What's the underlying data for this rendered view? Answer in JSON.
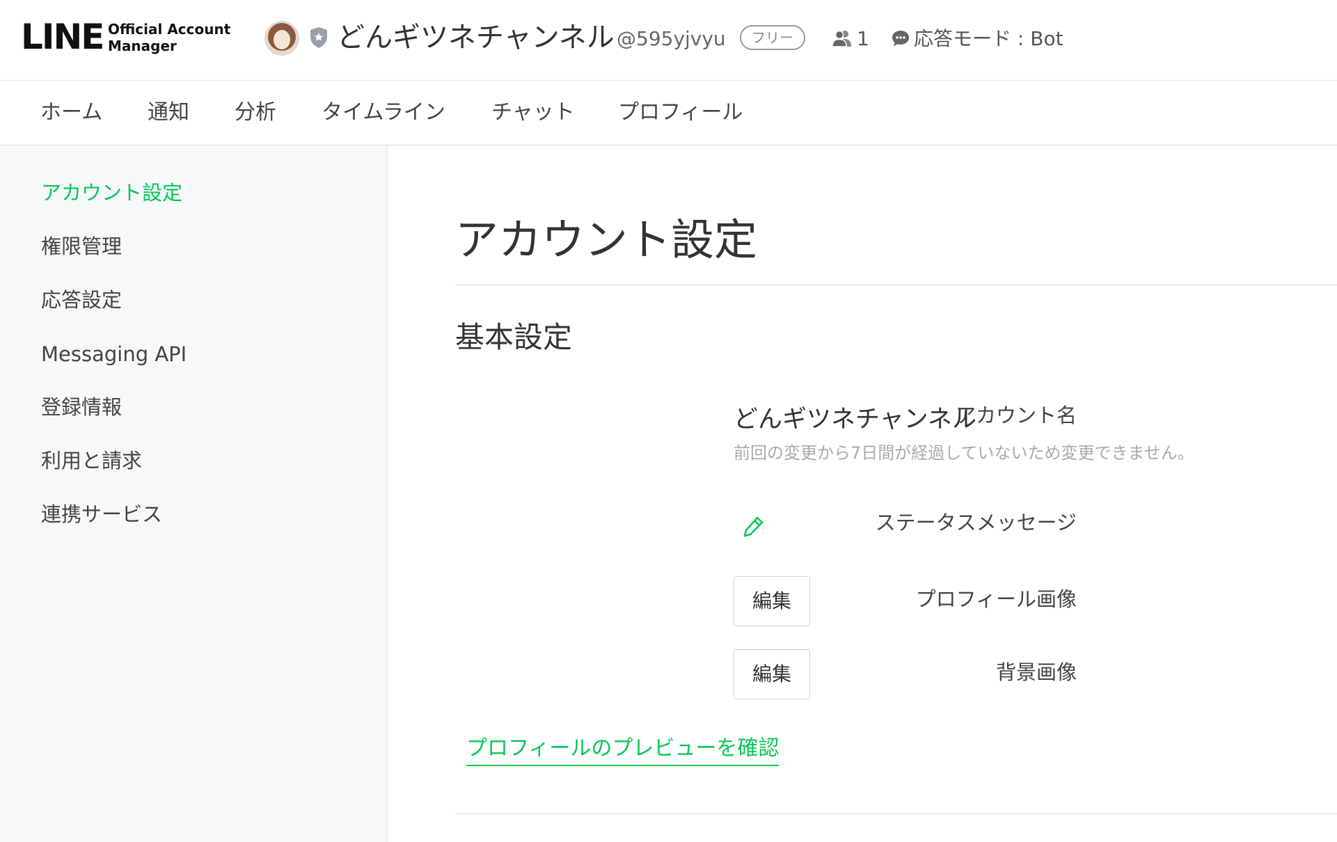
{
  "header": {
    "logo_main": "LINE",
    "logo_sub_line1": "Official Account",
    "logo_sub_line2": "Manager",
    "account_name": "どんギツネチャンネル",
    "account_id": "@595yjvyu",
    "plan_badge": "フリー",
    "friends_count": "1",
    "response_mode": "応答モード : Bot"
  },
  "nav": {
    "items": [
      "ホーム",
      "通知",
      "分析",
      "タイムライン",
      "チャット",
      "プロフィール"
    ]
  },
  "sidebar": {
    "items": [
      "アカウント設定",
      "権限管理",
      "応答設定",
      "Messaging API",
      "登録情報",
      "利用と請求",
      "連携サービス"
    ],
    "active_index": 0
  },
  "main": {
    "page_title": "アカウント設定",
    "section_title": "基本設定",
    "account_name_label": "アカウント名",
    "account_name_value": "どんギツネチャンネル",
    "account_name_note": "前回の変更から7日間が経過していないため変更できません。",
    "status_message_label": "ステータスメッセージ",
    "profile_image_label": "プロフィール画像",
    "background_image_label": "背景画像",
    "edit_button_label": "編集",
    "preview_link": "プロフィールのプレビューを確認"
  },
  "colors": {
    "accent_green": "#06c755",
    "sidebar_bg": "#f7f8fa"
  },
  "icons": {
    "shield": "shield-star-icon",
    "friends": "people-icon",
    "chat": "chat-bubble-icon",
    "pencil": "pencil-icon"
  }
}
